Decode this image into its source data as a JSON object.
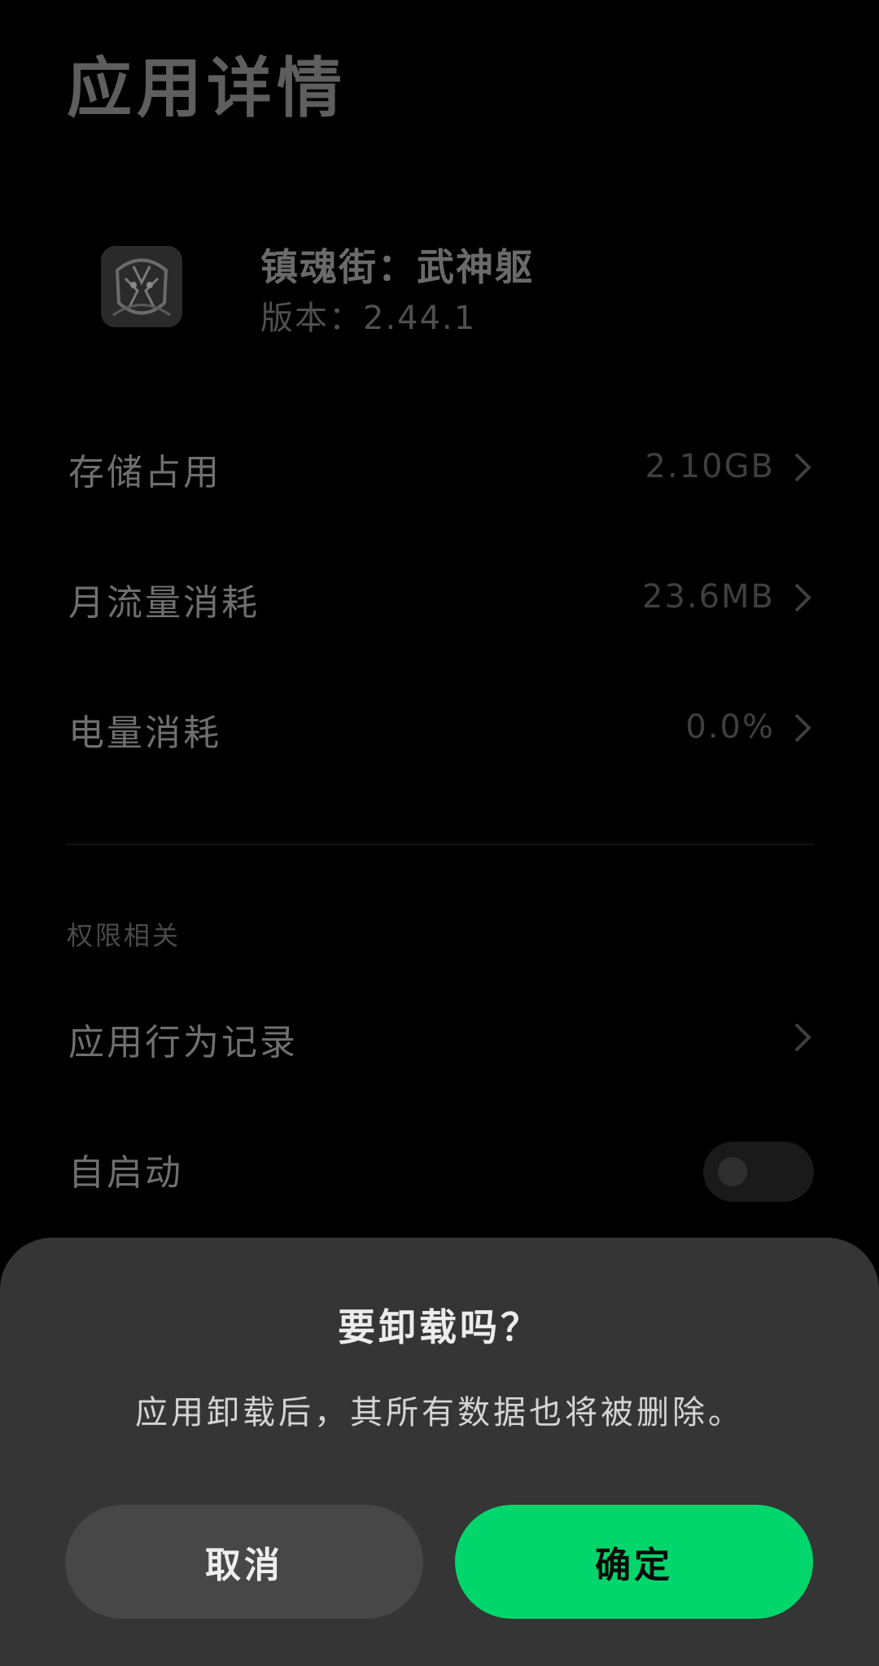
{
  "page": {
    "title": "应用详情"
  },
  "app": {
    "name": "镇魂街：武神躯",
    "version": "版本：2.44.1"
  },
  "usage": [
    {
      "label": "存储占用",
      "value": "2.10GB"
    },
    {
      "label": "月流量消耗",
      "value": "23.6MB"
    },
    {
      "label": "电量消耗",
      "value": "0.0%"
    }
  ],
  "permissions": {
    "section_label": "权限相关",
    "behavior_record_label": "应用行为记录",
    "autostart_label": "自启动",
    "autostart_enabled": false
  },
  "dialog": {
    "title": "要卸载吗？",
    "message": "应用卸载后，其所有数据也将被删除。",
    "cancel_label": "取消",
    "confirm_label": "确定"
  },
  "colors": {
    "accent": "#00d66c",
    "sheet": "#353535",
    "background": "#000000"
  }
}
